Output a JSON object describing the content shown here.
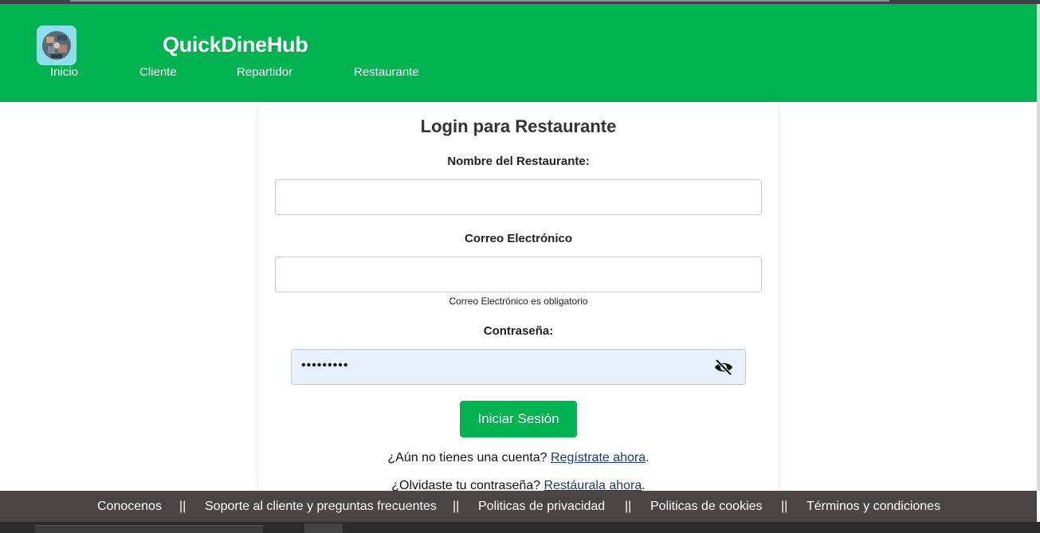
{
  "brand": {
    "name": "QuickDineHub",
    "logo_icon": "food-collage-logo-icon"
  },
  "nav": {
    "items": [
      "Inicio",
      "Cliente",
      "Repartidor",
      "Restaurante"
    ]
  },
  "form": {
    "title": "Login para Restaurante",
    "name_label": "Nombre del Restaurante:",
    "name_value": "",
    "email_label": "Correo Electrónico",
    "email_value": "",
    "email_error": "Correo Electrónico es obligatorio",
    "password_label": "Contraseña:",
    "password_masked": "•••••••••",
    "toggle_icon": "eye-slash-icon",
    "submit_label": "Iniciar Sesión",
    "register_prompt": "¿Aún no tienes una cuenta?",
    "register_link": "Regístrate ahora",
    "forgot_prompt": "¿Olvidaste tu contraseña?",
    "forgot_link": "Restáurala ahora",
    "period": "."
  },
  "footer": {
    "items": [
      "Conocenos",
      "Soporte al cliente y preguntas frecuentes",
      "Politicas de privacidad",
      "Politicas de cookies",
      "Términos y condiciones"
    ],
    "separator": "||"
  },
  "colors": {
    "accent": "#00b350",
    "footer_bg": "#4a4544",
    "link": "#1a3d6b",
    "autofill": "#e8f0fe"
  }
}
